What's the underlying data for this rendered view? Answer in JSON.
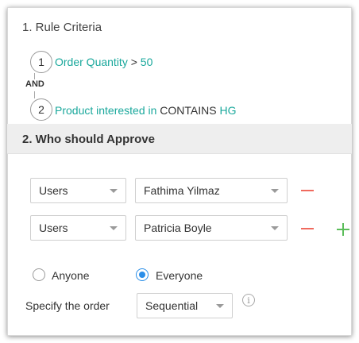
{
  "section1": {
    "title": "1.  Rule Criteria",
    "criteria": [
      {
        "index": "1",
        "field": "Order Quantity",
        "operator": ">",
        "value": "50"
      },
      {
        "index": "2",
        "field": "Product interested in",
        "operator": "CONTAINS",
        "value": "HG"
      }
    ],
    "connector": "AND"
  },
  "section2": {
    "title": "2.  Who should Approve",
    "approvers": [
      {
        "type": "Users",
        "name": "Fathima Yilmaz"
      },
      {
        "type": "Users",
        "name": "Patricia Boyle"
      }
    ],
    "approval_mode": {
      "options": [
        "Anyone",
        "Everyone"
      ],
      "selected": "Everyone"
    },
    "order": {
      "label": "Specify the order",
      "selected": "Sequential"
    }
  },
  "colors": {
    "accent_teal": "#1aa89c",
    "remove_red": "#f06a5e",
    "add_green": "#5bbd5a",
    "radio_blue": "#2a8ee8"
  },
  "icons": {
    "remove": "minus-icon",
    "add": "plus-icon",
    "info": "info-icon",
    "dropdown": "chevron-down-icon"
  }
}
